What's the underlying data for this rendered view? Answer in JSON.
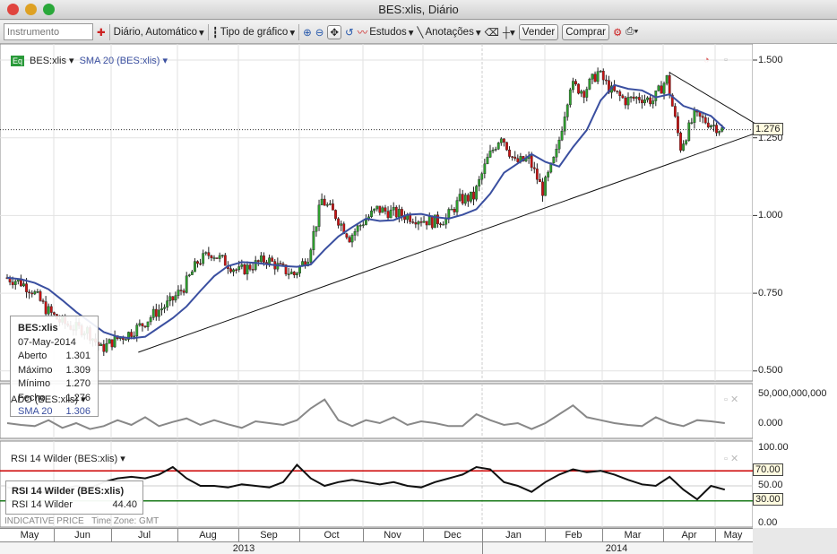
{
  "window": {
    "title": "BES:xlis, Diário"
  },
  "toolbar": {
    "instrument_placeholder": "Instrumento",
    "period": "Diário,  Automático",
    "chart_type": "Tipo de gráfico",
    "studies": "Estudos",
    "annotations": "Anotações",
    "sell": "Vender",
    "buy": "Comprar"
  },
  "main_pane": {
    "symbol": "BES:xlis",
    "study": "SMA 20 (BES:xlis)",
    "last_price": "1.276",
    "axis": [
      "1.500",
      "1.250",
      "1.000",
      "0.750",
      "0.500"
    ]
  },
  "tooltip": {
    "symbol": "BES:xlis",
    "date": "07-May-2014",
    "rows": [
      {
        "label": "Aberto",
        "value": "1.301"
      },
      {
        "label": "Máximo",
        "value": "1.309"
      },
      {
        "label": "Mínimo",
        "value": "1.270"
      },
      {
        "label": "Fecho",
        "value": "1.276"
      }
    ],
    "sma_label": "SMA 20",
    "sma_value": "1.306"
  },
  "ado_pane": {
    "title": "ADO (BES:xlis)",
    "axis": [
      "50,000,000,000",
      "0.000"
    ]
  },
  "rsi_pane": {
    "title": "RSI 14 Wilder (BES:xlis)",
    "axis": [
      "100.00",
      "50.00",
      "0.00"
    ],
    "tags": [
      "70.00",
      "30.00"
    ],
    "tooltip_title": "RSI 14 Wilder (BES:xlis)",
    "tooltip_label": "RSI 14 Wilder",
    "tooltip_value": "44.40"
  },
  "footer": {
    "indicative": "INDICATIVE PRICE",
    "timezone": "Time Zone: GMT"
  },
  "months": [
    "May",
    "Jun",
    "Jul",
    "Aug",
    "Sep",
    "Oct",
    "Nov",
    "Dec",
    "Jan",
    "Feb",
    "Mar",
    "Apr",
    "May"
  ],
  "years": [
    "2013",
    "2014"
  ],
  "colors": {
    "sma": "#3a4fa0",
    "up": "#2ea02e",
    "down": "#cc1111",
    "rsi_high": "#cc0000",
    "rsi_low": "#1a7a1a"
  },
  "chart_data": {
    "type": "candlestick",
    "period": "weekly-approx",
    "price_range": [
      0.45,
      1.55
    ],
    "close": [
      0.8,
      0.79,
      0.76,
      0.7,
      0.66,
      0.64,
      0.63,
      0.57,
      0.6,
      0.62,
      0.65,
      0.69,
      0.72,
      0.77,
      0.85,
      0.88,
      0.85,
      0.82,
      0.84,
      0.86,
      0.83,
      0.81,
      0.87,
      1.05,
      1.0,
      0.93,
      0.98,
      1.02,
      1.01,
      1.0,
      0.99,
      0.98,
      0.99,
      1.05,
      1.06,
      1.18,
      1.26,
      1.17,
      1.18,
      1.08,
      1.2,
      1.42,
      1.4,
      1.46,
      1.4,
      1.37,
      1.38,
      1.37,
      1.44,
      1.22,
      1.32,
      1.3,
      1.276
    ],
    "rsi": [
      48,
      45,
      40,
      42,
      45,
      50,
      47,
      55,
      60,
      62,
      60,
      65,
      75,
      60,
      50,
      50,
      48,
      52,
      50,
      48,
      55,
      78,
      60,
      50,
      55,
      58,
      55,
      52,
      55,
      50,
      48,
      55,
      60,
      65,
      75,
      72,
      55,
      50,
      42,
      55,
      65,
      72,
      68,
      70,
      65,
      58,
      52,
      50,
      62,
      45,
      32,
      50,
      45
    ],
    "ado_billions": [
      0,
      -3,
      -5,
      5,
      -8,
      0,
      -10,
      -5,
      5,
      -3,
      10,
      -5,
      2,
      8,
      -3,
      5,
      -2,
      -8,
      3,
      0,
      -3,
      5,
      25,
      40,
      5,
      -5,
      5,
      0,
      10,
      -3,
      3,
      0,
      -5,
      -5,
      15,
      5,
      -3,
      0,
      -10,
      0,
      15,
      30,
      10,
      5,
      0,
      -3,
      -5,
      10,
      0,
      -5,
      5,
      3,
      0
    ],
    "trendlines": [
      {
        "from": [
          9.5,
          0.56
        ],
        "to": [
          53,
          1.276
        ]
      },
      {
        "from": [
          48,
          1.46
        ],
        "to": [
          53,
          1.276
        ]
      }
    ]
  }
}
